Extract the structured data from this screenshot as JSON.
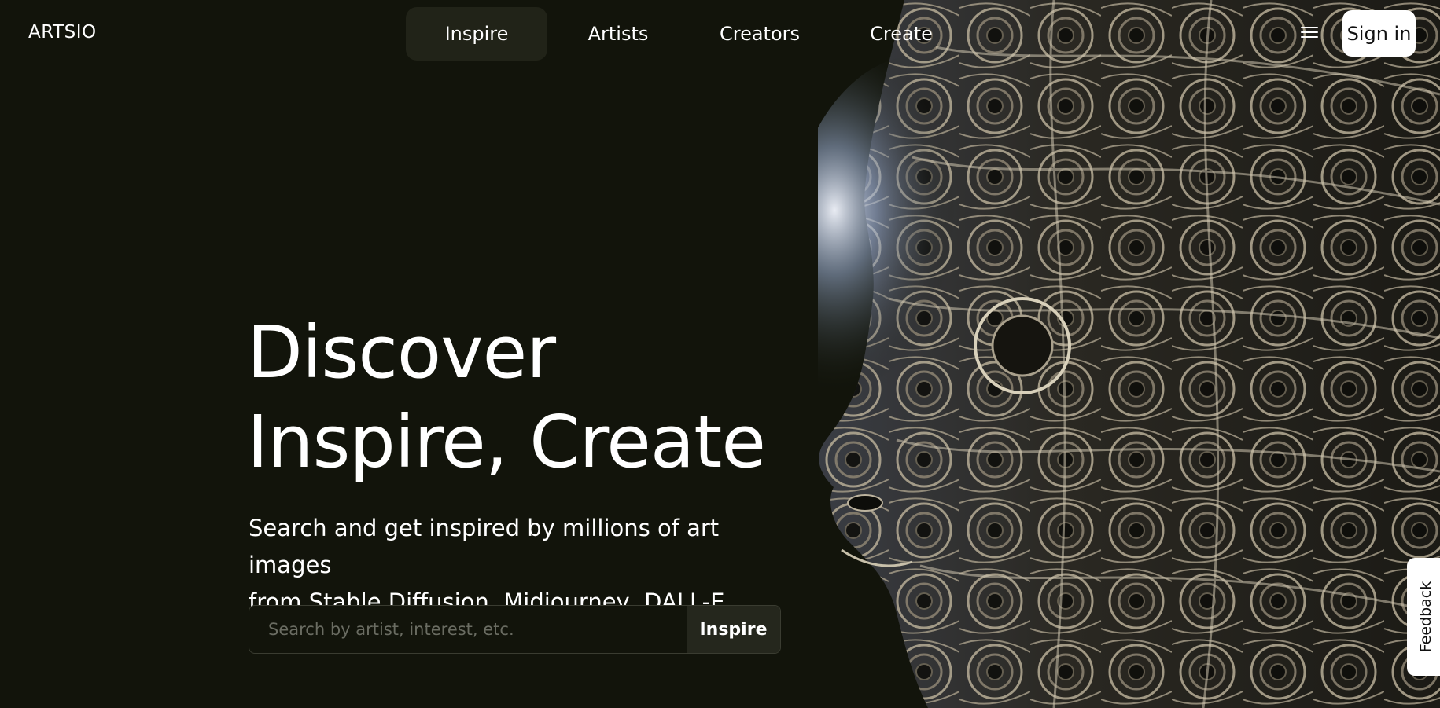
{
  "brand": {
    "logo": "ARTSIO"
  },
  "nav": {
    "items": [
      {
        "label": "Inspire",
        "active": true
      },
      {
        "label": "Artists",
        "active": false
      },
      {
        "label": "Creators",
        "active": false
      },
      {
        "label": "Create",
        "active": false
      }
    ],
    "menu_icon": "hamburger-menu-icon",
    "signin_label": "Sign in"
  },
  "hero": {
    "headline_line1": "Discover",
    "headline_line2": "Inspire, Create",
    "subline_line1": "Search and get inspired by millions of art images",
    "subline_line2": "from Stable Diffusion, Midjourney, DALL-E..."
  },
  "search": {
    "placeholder": "Search by artist, interest, etc.",
    "value": "",
    "button_label": "Inspire"
  },
  "feedback": {
    "label": "Feedback"
  },
  "colors": {
    "background": "#12140b",
    "nav_active": "#212318",
    "search_button": "#25271d",
    "signin_bg": "#ffffff"
  }
}
